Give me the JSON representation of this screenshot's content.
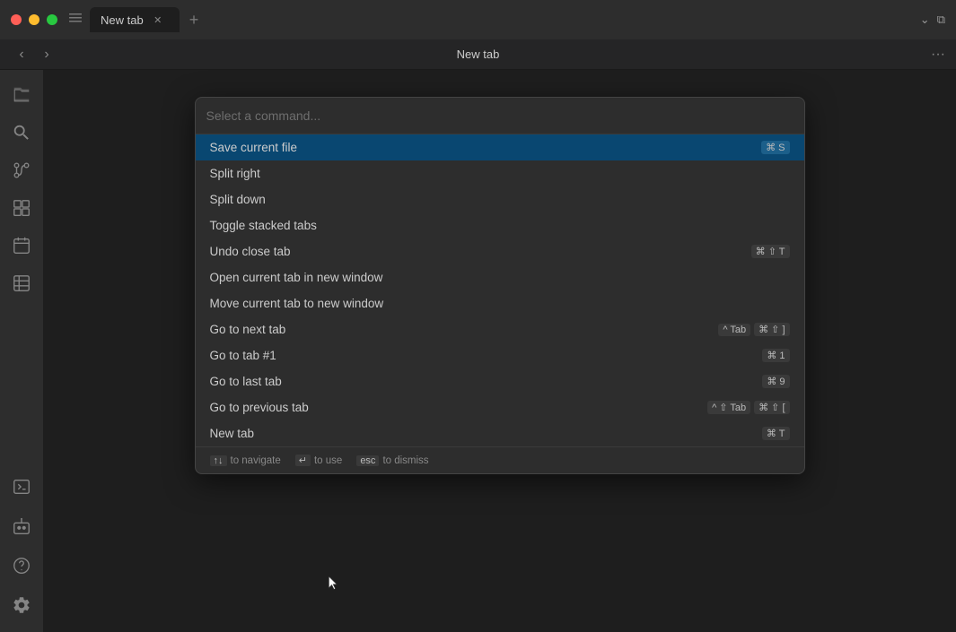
{
  "window": {
    "title": "New tab"
  },
  "titlebar": {
    "traffic_lights": {
      "close_label": "close",
      "minimize_label": "minimize",
      "maximize_label": "maximize"
    },
    "tab_label": "New tab",
    "new_tab_label": "+",
    "sidebar_toggle_icon": "sidebar"
  },
  "toolbar": {
    "title": "New tab",
    "back_label": "‹",
    "forward_label": "›",
    "more_label": "···"
  },
  "activity_bar": {
    "icons": [
      {
        "name": "explorer-icon",
        "symbol": "⊞",
        "label": "Explorer"
      },
      {
        "name": "search-icon",
        "symbol": "⌕",
        "label": "Search"
      },
      {
        "name": "source-control-icon",
        "symbol": "⑂",
        "label": "Source Control"
      },
      {
        "name": "extensions-icon",
        "symbol": "⊟",
        "label": "Extensions"
      },
      {
        "name": "calendar-icon",
        "symbol": "⊡",
        "label": "Calendar"
      },
      {
        "name": "pages-icon",
        "symbol": "⊠",
        "label": "Pages"
      }
    ],
    "bottom_icons": [
      {
        "name": "terminal-icon",
        "symbol": "⊞",
        "label": "Terminal"
      },
      {
        "name": "robot-icon",
        "symbol": "⊡",
        "label": "AI"
      },
      {
        "name": "help-icon",
        "symbol": "?",
        "label": "Help"
      },
      {
        "name": "settings-icon",
        "symbol": "⚙",
        "label": "Settings"
      }
    ]
  },
  "command_palette": {
    "input_placeholder": "Select a command...",
    "commands": [
      {
        "label": "Save current file",
        "shortcut": "⌘ S",
        "selected": true
      },
      {
        "label": "Split right",
        "shortcut": ""
      },
      {
        "label": "Split down",
        "shortcut": ""
      },
      {
        "label": "Toggle stacked tabs",
        "shortcut": ""
      },
      {
        "label": "Undo close tab",
        "shortcut": "⌘ ⇧ T"
      },
      {
        "label": "Open current tab in new window",
        "shortcut": ""
      },
      {
        "label": "Move current tab to new window",
        "shortcut": ""
      },
      {
        "label": "Go to next tab",
        "shortcut_parts": [
          "^ Tab",
          "⌘ ⇧ ]"
        ]
      },
      {
        "label": "Go to tab #1",
        "shortcut": "⌘ 1"
      },
      {
        "label": "Go to last tab",
        "shortcut": "⌘ 9"
      },
      {
        "label": "Go to previous tab",
        "shortcut_parts": [
          "^ ⇧ Tab",
          "⌘ ⇧ ["
        ]
      },
      {
        "label": "New tab",
        "shortcut": "⌘ T"
      }
    ],
    "footer": {
      "navigate_hint": "↑↓ to navigate",
      "use_hint": "↵ to use",
      "dismiss_hint": "esc to dismiss"
    }
  }
}
